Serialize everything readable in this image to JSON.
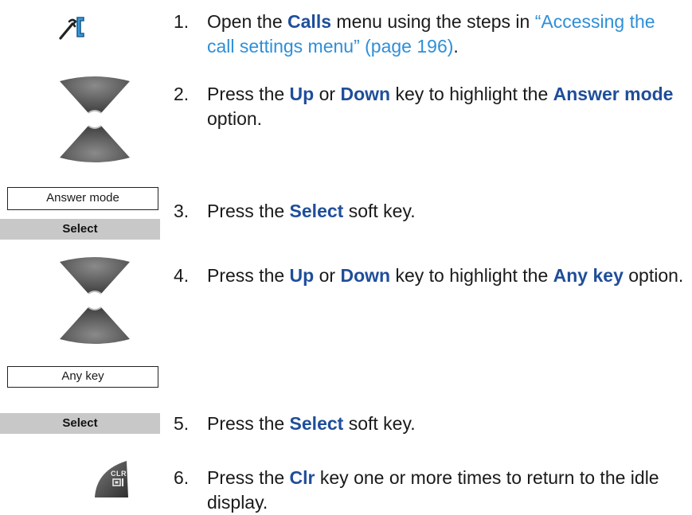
{
  "icons": {
    "calls_menu": "phone-wrench-icon",
    "nav_up": "nav-up-key-icon",
    "nav_down": "nav-down-key-icon",
    "clr_key": "clr-key-icon"
  },
  "displays": {
    "answer_mode": "Answer mode",
    "any_key": "Any key"
  },
  "softkeys": {
    "select_1": "Select",
    "select_2": "Select"
  },
  "clr_key_label": "CLR",
  "steps": [
    {
      "num": "1.",
      "pre": "Open the ",
      "kw1": "Calls",
      "mid": " menu using the steps in ",
      "link": "“Accessing the call settings menu” (page 196)",
      "post": "."
    },
    {
      "num": "2.",
      "pre": "Press the ",
      "kw1": "Up",
      "mid1": " or ",
      "kw2": "Down",
      "mid2": " key to highlight the ",
      "kw3": "Answer mode",
      "post": " option."
    },
    {
      "num": "3.",
      "pre": "Press the ",
      "kw1": "Select",
      "post": " soft key."
    },
    {
      "num": "4.",
      "pre": "Press the ",
      "kw1": "Up",
      "mid1": " or ",
      "kw2": "Down",
      "mid2": " key to highlight the ",
      "kw3": "Any key",
      "post": " option."
    },
    {
      "num": "5.",
      "pre": "Press the ",
      "kw1": "Select",
      "post": " soft key."
    },
    {
      "num": "6.",
      "pre": "Press the ",
      "kw1": "Clr",
      "post": " key one or more times to return to the idle display."
    }
  ],
  "colors": {
    "keyword": "#1f4e9a",
    "link": "#2f8fd8",
    "softkey_bg": "#c8c8c8",
    "nav_key_dark": "#4a4a4a"
  }
}
